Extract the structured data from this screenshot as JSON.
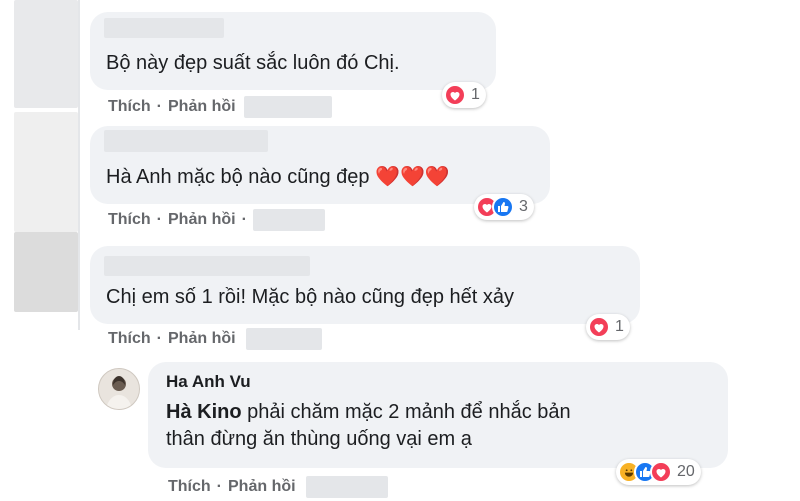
{
  "comments": [
    {
      "text": "Bộ này đẹp suất sắc luôn đó Chị.",
      "reaction_count": "1"
    },
    {
      "text": "Hà Anh mặc bộ nào cũng đẹp ❤️❤️❤️",
      "reaction_count": "3"
    },
    {
      "text": "Chị em số 1 rồi! Mặc bộ nào cũng đẹp hết xảy",
      "reaction_count": "1"
    }
  ],
  "reply": {
    "author": "Ha Anh Vu",
    "mention": "Hà Kino",
    "text_line1": " phải chăm mặc 2 mảnh để nhắc bản",
    "text_line2": "thân đừng ăn thùng uống vại em ạ",
    "reaction_count": "20"
  },
  "actions": {
    "like": "Thích",
    "reply": "Phản hồi",
    "dot": "·"
  },
  "colors": {
    "bubble": "#f0f2f5",
    "love": "#f33e58",
    "like": "#1877f2",
    "haha": "#f7b125",
    "meta": "#65676b"
  }
}
